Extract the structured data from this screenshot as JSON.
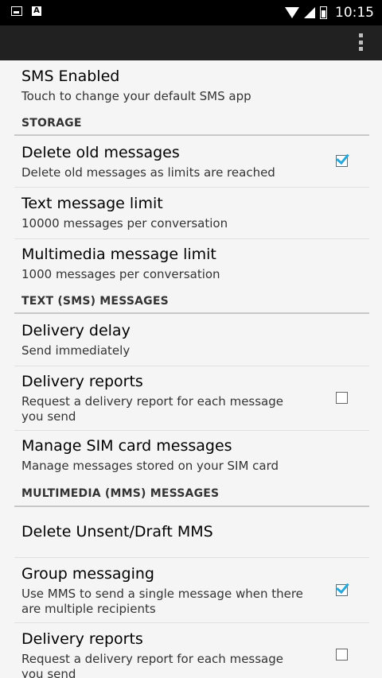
{
  "status_bar": {
    "time": "10:15",
    "notification_letter": "A"
  },
  "preferences": [
    {
      "id": "sms-enabled",
      "title": "SMS Enabled",
      "summary": "Touch to change your default SMS app"
    },
    {
      "id": "delete-old-messages",
      "title": "Delete old messages",
      "summary": "Delete old messages as limits are reached",
      "checked": true
    },
    {
      "id": "text-message-limit",
      "title": "Text message limit",
      "summary": "10000 messages per conversation"
    },
    {
      "id": "multimedia-message-limit",
      "title": "Multimedia message limit",
      "summary": "1000 messages per conversation"
    },
    {
      "id": "delivery-delay",
      "title": "Delivery delay",
      "summary": "Send immediately"
    },
    {
      "id": "delivery-reports-sms",
      "title": "Delivery reports",
      "summary": "Request a delivery report for each message you send",
      "checked": false
    },
    {
      "id": "manage-sim-card-messages",
      "title": "Manage SIM card messages",
      "summary": "Manage messages stored on your SIM card"
    },
    {
      "id": "delete-unsent-draft-mms",
      "title": "Delete Unsent/Draft MMS"
    },
    {
      "id": "group-messaging",
      "title": "Group messaging",
      "summary": "Use MMS to send a single message when there are multiple recipients",
      "checked": true
    },
    {
      "id": "delivery-reports-mms",
      "title": "Delivery reports",
      "summary": "Request a delivery report for each message you send",
      "checked": false
    }
  ],
  "categories": [
    "STORAGE",
    "TEXT (SMS) MESSAGES",
    "MULTIMEDIA (MMS) MESSAGES"
  ]
}
